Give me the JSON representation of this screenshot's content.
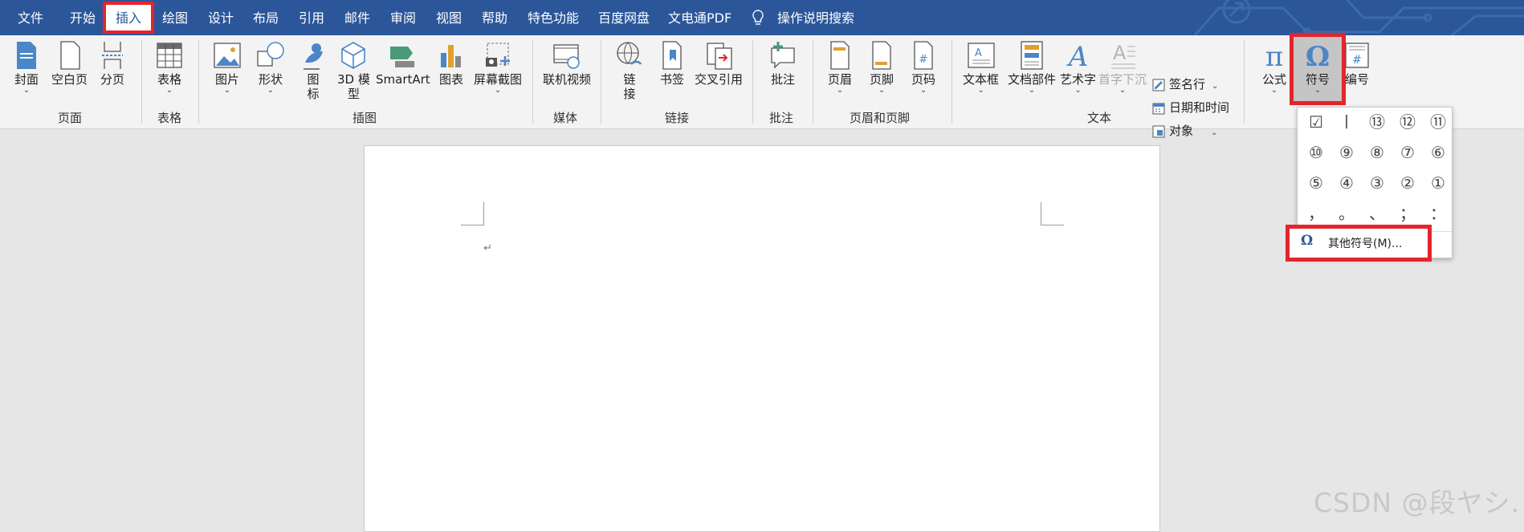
{
  "tabs": {
    "file": "文件",
    "home": "开始",
    "insert": "插入",
    "draw": "绘图",
    "design": "设计",
    "layout": "布局",
    "references": "引用",
    "mailings": "邮件",
    "review": "审阅",
    "view": "视图",
    "help": "帮助",
    "special": "特色功能",
    "baidu": "百度网盘",
    "wendiantong": "文电通PDF",
    "tell_me": "操作说明搜索"
  },
  "ribbon": {
    "pages": {
      "cover": "封面",
      "blank": "空白页",
      "break": "分页",
      "label": "页面"
    },
    "tables": {
      "table": "表格",
      "label": "表格"
    },
    "illustrations": {
      "pictures": "图片",
      "shapes": "形状",
      "icons_1": "图",
      "icons_2": "标",
      "models_1": "3D 模",
      "models_2": "型",
      "smartart": "SmartArt",
      "chart": "图表",
      "screenshot": "屏幕截图",
      "label": "插图"
    },
    "media": {
      "video": "联机视频",
      "label": "媒体"
    },
    "links": {
      "link_1": "链",
      "link_2": "接",
      "bookmark": "书签",
      "crossref": "交叉引用",
      "label": "链接"
    },
    "comments": {
      "comment": "批注",
      "label": "批注"
    },
    "header_footer": {
      "header": "页眉",
      "footer": "页脚",
      "page_number": "页码",
      "label": "页眉和页脚"
    },
    "text": {
      "textbox": "文本框",
      "quickparts": "文档部件",
      "wordart": "艺术字",
      "dropcap": "首字下沉",
      "signature": "签名行",
      "datetime": "日期和时间",
      "object": "对象",
      "label": "文本"
    },
    "symbols": {
      "equation": "公式",
      "symbol": "符号",
      "number": "编号"
    }
  },
  "symbol_dropdown": {
    "rows": [
      [
        "☑",
        "〡",
        "⑬",
        "⑫",
        "⑪"
      ],
      [
        "⑩",
        "⑨",
        "⑧",
        "⑦",
        "⑥"
      ],
      [
        "⑤",
        "④",
        "③",
        "②",
        "①"
      ],
      [
        "，",
        "。",
        "、",
        "；",
        "："
      ]
    ],
    "more_symbols": "其他符号(M)..."
  },
  "document": {
    "paragraph_mark": "↵"
  },
  "watermark": "CSDN @段ヤシ.",
  "colors": {
    "ribbon_blue": "#2b579a",
    "highlight_red": "#e5242b",
    "accent_icon_blue": "#4a86c8"
  },
  "icons": [
    "lightbulb-icon",
    "omega-icon",
    "pi-icon",
    "table-grid-icon",
    "globe-link-icon"
  ]
}
